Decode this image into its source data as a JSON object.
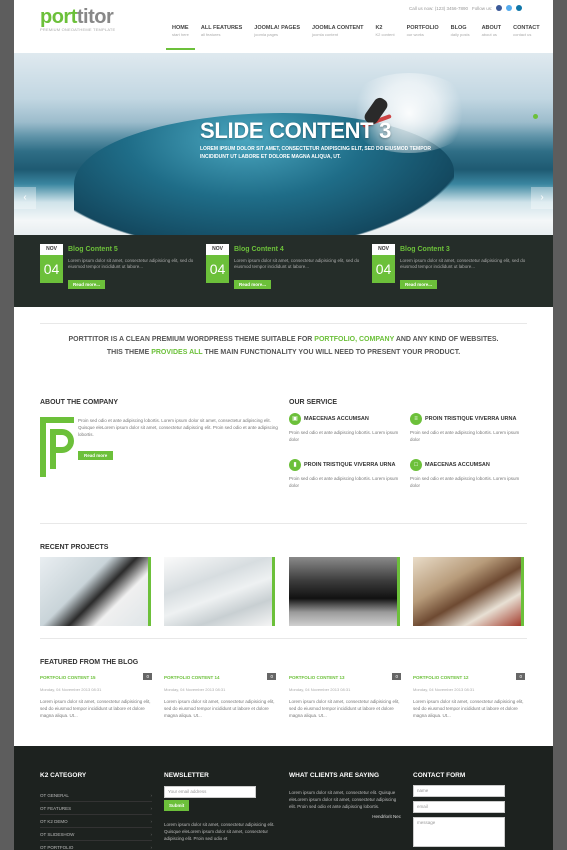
{
  "brand": {
    "logo_green": "port",
    "logo_dark": "titor",
    "tagline": "PREMIUM ONEOATHEME TEMPLATE"
  },
  "topbar": {
    "call": "Call us now: (123) 3456-7890",
    "follow": "Follow us:"
  },
  "nav": [
    {
      "label": "HOME",
      "sub": "start here"
    },
    {
      "label": "ALL FEATURES",
      "sub": "all features"
    },
    {
      "label": "JOOMLA! PAGES",
      "sub": "joomla pages"
    },
    {
      "label": "JOOMLA CONTENT",
      "sub": "joomla content"
    },
    {
      "label": "K2",
      "sub": "K2 content"
    },
    {
      "label": "PORTFOLIO",
      "sub": "our works"
    },
    {
      "label": "BLOG",
      "sub": "daily posts"
    },
    {
      "label": "ABOUT",
      "sub": "about us"
    },
    {
      "label": "CONTACT",
      "sub": "contact us"
    }
  ],
  "slider": {
    "title": "SLIDE CONTENT 3",
    "text": "LOREM IPSUM DOLOR SIT AMET, CONSECTETUR ADIPISCING ELIT, SED DO EIUSMOD TEMPOR INCIDIDUNT UT LABORE ET DOLORE MAGNA ALIQUA, UT."
  },
  "blog_strip": [
    {
      "month": "NOV",
      "day": "04",
      "title": "Blog Content 5",
      "text": "Lorem ipsum dolor sit amet, consectetur adipisicing elit, sed do eiusmod tempor incididunt ut labore...",
      "more": "Read more..."
    },
    {
      "month": "NOV",
      "day": "04",
      "title": "Blog Content 4",
      "text": "Lorem ipsum dolor sit amet, consectetur adipisicing elit, sed do eiusmod tempor incididunt ut labore...",
      "more": "Read more..."
    },
    {
      "month": "NOV",
      "day": "04",
      "title": "Blog Content 3",
      "text": "Lorem ipsum dolor sit amet, consectetur adipisicing elit, sed do eiusmod tempor incididunt ut labore...",
      "more": "Read more..."
    }
  ],
  "intro": {
    "a": "PORTTITOR IS A CLEAN PREMIUM WORDPRESS THEME SUITABLE FOR ",
    "b": "PORTFOLIO, COMPANY",
    "c": " AND ANY KIND OF WEBSITES.",
    "d": "THIS THEME ",
    "e": "PROVIDES ALL",
    "f": " THE MAIN FUNCTIONALITY YOU WILL NEED TO PRESENT YOUR PRODUCT."
  },
  "about": {
    "title": "ABOUT THE COMPANY",
    "text": "Proin sed odio et ante adipiscing lobortis. Lorem ipsum dolor sit amet, consectetur adipiscing elit. Quisque eleLorem ipsum dolor sit amet, consectetur adipiscing elit. Proin sed odio et ante adipiscing lobortis.",
    "more": "Read more"
  },
  "service": {
    "title": "OUR SERVICE",
    "items": [
      {
        "title": "MAECENAS ACCUMSAN",
        "text": "Proin sed odio et ante adipiscing lobortis. Lorem ipsum dolor"
      },
      {
        "title": "PROIN TRISTIQUE VIVERRA URNA",
        "text": "Proin sed odio et ante adipiscing lobortis. Lorem ipsum dolor"
      },
      {
        "title": "PROIN TRISTIQUE VIVERRA URNA",
        "text": "Proin sed odio et ante adipiscing lobortis. Lorem ipsum dolor"
      },
      {
        "title": "MAECENAS ACCUMSAN",
        "text": "Proin sed odio et ante adipiscing lobortis. Lorem ipsum dolor"
      }
    ]
  },
  "projects": {
    "title": "RECENT PROJECTS"
  },
  "featured": {
    "title": "FEATURED FROM THE BLOG",
    "items": [
      {
        "title": "PORTFOLIO CONTENT 15",
        "count": "0",
        "date": "Monday, 04 November 2013 08:31",
        "text": "Lorem ipsum dolor sit amet, consectetur adipisicing elit, sed do eiusmod tempor incididunt ut labore et dolore magna aliqua. Ut..."
      },
      {
        "title": "PORTFOLIO CONTENT 14",
        "count": "0",
        "date": "Monday, 04 November 2013 08:31",
        "text": "Lorem ipsum dolor sit amet, consectetur adipisicing elit, sed do eiusmod tempor incididunt ut labore et dolore magna aliqua. Ut..."
      },
      {
        "title": "PORTFOLIO CONTENT 13",
        "count": "0",
        "date": "Monday, 04 November 2013 08:31",
        "text": "Lorem ipsum dolor sit amet, consectetur adipisicing elit, sed do eiusmod tempor incididunt ut labore et dolore magna aliqua. Ut..."
      },
      {
        "title": "PORTFOLIO CONTENT 12",
        "count": "0",
        "date": "Monday, 04 November 2013 08:31",
        "text": "Lorem ipsum dolor sit amet, consectetur adipisicing elit, sed do eiusmod tempor incididunt ut labore et dolore magna aliqua. Ut..."
      }
    ]
  },
  "footer": {
    "k2": {
      "title": "K2 CATEGORY",
      "items": [
        "OT GENERAL",
        "OT FEATURES",
        "OT K2 DEMO",
        "OT SLIDESHOW",
        "OT PORTFOLIO"
      ]
    },
    "newsletter": {
      "title": "NEWSLETTER",
      "placeholder": "Your email address",
      "submit": "Submit",
      "text": "Lorem ipsum dolor sit amet, consectetur adipisicing elit. Quisque eleLorem ipsum dolor sit amet, consectetur adipiscing elit. Proin sed odio et"
    },
    "clients": {
      "title": "WHAT CLIENTS ARE SAYING",
      "text": "Lorem ipsum dolor sit amet, consectetur elit. Quisque eleLorem ipsum dolor sit amet, consectetur adipiscing elit. Proin sed odio et ante adipiscing lobortis.",
      "author": "Hendrlorit Nec"
    },
    "contact": {
      "title": "CONTACT FORM",
      "name": "name",
      "email": "email",
      "message": "message"
    }
  },
  "colors": {
    "accent": "#6cc03a",
    "dark": "#252d29"
  }
}
